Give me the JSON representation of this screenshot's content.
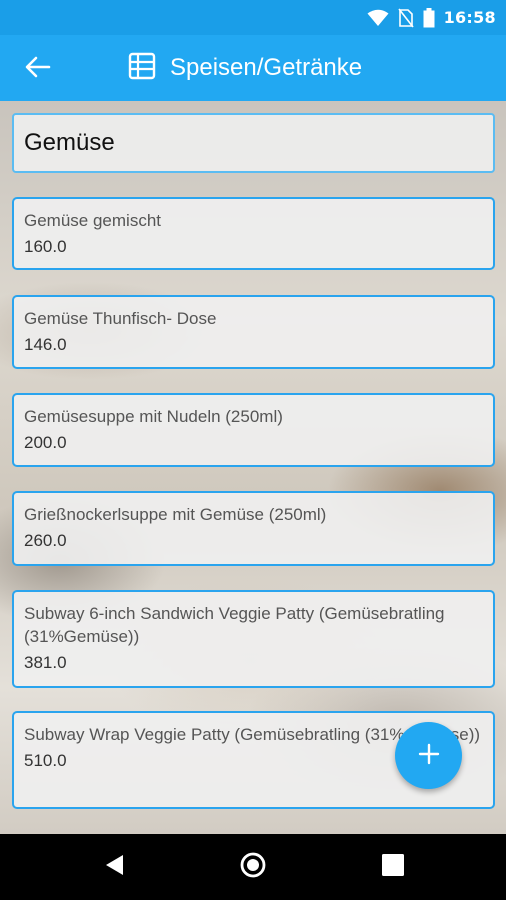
{
  "status_bar": {
    "time": "16:58",
    "icons": [
      "wifi-icon",
      "no-sim-icon",
      "battery-icon"
    ]
  },
  "app_bar": {
    "back_icon": "arrow-left-icon",
    "title_icon": "table-icon",
    "title": "Speisen/Getränke"
  },
  "category": {
    "value": "Gemüse"
  },
  "items": [
    {
      "name": "Gemüse gemischt",
      "value": "160.0"
    },
    {
      "name": "Gemüse Thunfisch- Dose",
      "value": "146.0"
    },
    {
      "name": "Gemüsesuppe mit Nudeln (250ml)",
      "value": "200.0"
    },
    {
      "name": "Grießnockerlsuppe mit Gemüse (250ml)",
      "value": "260.0"
    },
    {
      "name": "Subway 6-inch Sandwich Veggie Patty (Gemüsebratling (31%Gemüse))",
      "value": "381.0"
    },
    {
      "name": "Subway Wrap Veggie Patty (Gemüsebratling (31%Gemüse))",
      "value": "510.0"
    }
  ],
  "fab": {
    "icon": "plus-icon"
  },
  "nav_bar": {
    "icons": [
      "back-triangle-icon",
      "home-circle-icon",
      "recents-square-icon"
    ]
  },
  "colors": {
    "primary": "#22a8f2",
    "status_bar": "#1a9ee8",
    "card_border": "#2aa4ee"
  }
}
